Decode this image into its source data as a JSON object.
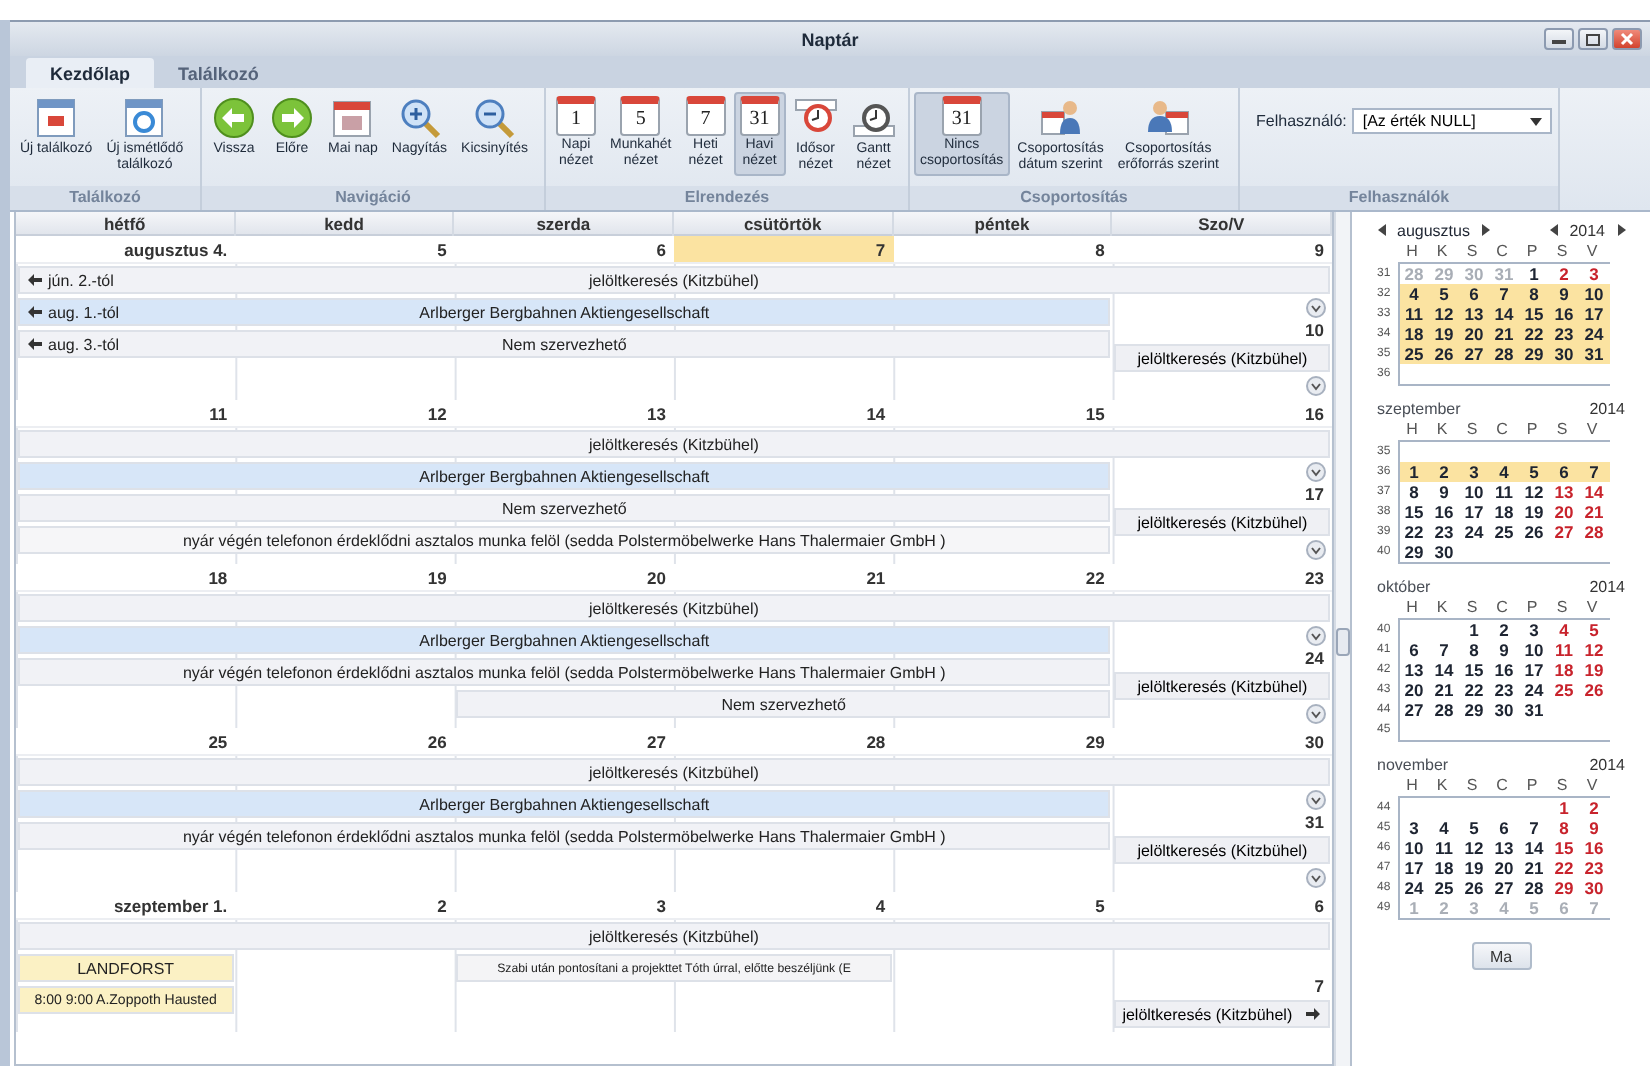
{
  "window": {
    "title": "Naptár"
  },
  "tabs": [
    {
      "label": "Kezdőlap",
      "selected": true
    },
    {
      "label": "Találkozó",
      "selected": false
    }
  ],
  "ribbon": [
    {
      "title": "Találkozó",
      "kind": "buttons",
      "buttons": [
        {
          "label": "Új találkozó",
          "selected": false
        },
        {
          "label": "Új ismétlődő\ntalálkozó",
          "selected": false
        }
      ]
    },
    {
      "title": "Navigáció",
      "kind": "buttons",
      "buttons": [
        {
          "label": "Vissza",
          "selected": false
        },
        {
          "label": "Előre",
          "selected": false
        },
        {
          "label": "Mai nap",
          "selected": false
        },
        {
          "label": "Nagyítás",
          "selected": false
        },
        {
          "label": "Kicsinyítés",
          "selected": false
        }
      ]
    },
    {
      "title": "Elrendezés",
      "kind": "buttons",
      "buttons": [
        {
          "label": "Napi\nnézet",
          "badge": "1",
          "selected": false
        },
        {
          "label": "Munkahét\nnézet",
          "badge": "5",
          "selected": false
        },
        {
          "label": "Heti\nnézet",
          "badge": "7",
          "selected": false
        },
        {
          "label": "Havi\nnézet",
          "badge": "31",
          "selected": true
        },
        {
          "label": "Idősor\nnézet",
          "selected": false
        },
        {
          "label": "Gantt\nnézet",
          "selected": false
        }
      ]
    },
    {
      "title": "Csoportosítás",
      "kind": "buttons",
      "buttons": [
        {
          "label": "Nincs\ncsoportosítás",
          "badge": "31",
          "selected": true
        },
        {
          "label": "Csoportosítás\ndátum szerint",
          "selected": false
        },
        {
          "label": "Csoportosítás\nerőforrás szerint",
          "selected": false
        }
      ]
    },
    {
      "title": "Felhasználók",
      "kind": "filter",
      "filter": {
        "label": "Felhasználó:",
        "value": "[Az érték NULL]"
      }
    }
  ],
  "calendar": {
    "columns": [
      "hétfő",
      "kedd",
      "szerda",
      "csütörtök",
      "péntek",
      "Szo/V"
    ],
    "weeks": [
      {
        "days": [
          {
            "label": "augusztus 4.",
            "today": false
          },
          {
            "label": "5",
            "today": false
          },
          {
            "label": "6",
            "today": false
          },
          {
            "label": "7",
            "today": true
          },
          {
            "label": "8",
            "today": false
          },
          {
            "label": "9",
            "today": false
          }
        ],
        "all_week": {
          "title": "jelöltkeresés (Kitzbühel)",
          "from": "jún. 2.-tól",
          "color": "#f1f2f6"
        },
        "lines": [
          [
            {
              "kind": "event",
              "title": "Arlberger Bergbahnen Aktiengesellschaft",
              "from": "aug. 1.-tól",
              "color": "#d7e6f8"
            },
            {
              "kind": "continued"
            },
            {
              "kind": "continued"
            },
            {
              "kind": "continued"
            },
            {
              "kind": "continued"
            }
          ],
          [
            {
              "kind": "event",
              "title": "Nem szervezhető",
              "from": "aug. 3.-tól",
              "color": "#f1f2f6"
            },
            {
              "kind": "continued"
            },
            {
              "kind": "continued"
            },
            {
              "kind": "continued"
            },
            {
              "kind": "continued"
            }
          ]
        ],
        "weekend": {
          "sat_more": true,
          "sunday": "10",
          "events": [
            {
              "title": "jelöltkeresés (Kitzbühel)",
              "continues": false
            }
          ],
          "sun_more": true
        }
      },
      {
        "days": [
          {
            "label": "11",
            "today": false
          },
          {
            "label": "12",
            "today": false
          },
          {
            "label": "13",
            "today": false
          },
          {
            "label": "14",
            "today": false
          },
          {
            "label": "15",
            "today": false
          },
          {
            "label": "16",
            "today": false
          }
        ],
        "all_week": {
          "title": "jelöltkeresés (Kitzbühel)",
          "color": "#f1f2f6"
        },
        "lines": [
          [
            {
              "kind": "event",
              "title": "Arlberger Bergbahnen Aktiengesellschaft",
              "color": "#d7e6f8"
            },
            {
              "kind": "continued"
            },
            {
              "kind": "continued"
            },
            {
              "kind": "continued"
            },
            {
              "kind": "continued"
            }
          ],
          [
            {
              "kind": "event",
              "title": "Nem szervezhető",
              "color": "#f1f2f6"
            },
            {
              "kind": "continued"
            },
            {
              "kind": "continued"
            },
            {
              "kind": "continued"
            },
            {
              "kind": "continued"
            }
          ],
          [
            {
              "kind": "event",
              "title": "nyár végén telefonon érdeklődni asztalos munka felöl (sedda Polstermöbelwerke Hans Thalermaier GmbH )",
              "color": "#f6f6f8"
            },
            {
              "kind": "continued"
            },
            {
              "kind": "continued"
            },
            {
              "kind": "continued"
            },
            {
              "kind": "continued"
            }
          ]
        ],
        "weekend": {
          "sat_more": true,
          "sunday": "17",
          "events": [
            {
              "title": "jelöltkeresés (Kitzbühel)",
              "continues": false
            }
          ],
          "sun_more": true
        }
      },
      {
        "days": [
          {
            "label": "18",
            "today": false
          },
          {
            "label": "19",
            "today": false
          },
          {
            "label": "20",
            "today": false
          },
          {
            "label": "21",
            "today": false
          },
          {
            "label": "22",
            "today": false
          },
          {
            "label": "23",
            "today": false
          }
        ],
        "all_week": {
          "title": "jelöltkeresés (Kitzbühel)",
          "color": "#f1f2f6"
        },
        "lines": [
          [
            {
              "kind": "event",
              "title": "Arlberger Bergbahnen Aktiengesellschaft",
              "color": "#d7e6f8"
            },
            {
              "kind": "continued"
            },
            {
              "kind": "continued"
            },
            {
              "kind": "continued"
            },
            {
              "kind": "continued"
            }
          ],
          [
            {
              "kind": "event",
              "title": "nyár végén telefonon érdeklődni asztalos munka felöl (sedda Polstermöbelwerke Hans Thalermaier GmbH )",
              "color": "#f1f2f6"
            },
            {
              "kind": "continued"
            },
            {
              "kind": "continued"
            },
            {
              "kind": "continued"
            },
            {
              "kind": "continued"
            }
          ],
          [
            {
              "kind": "empty"
            },
            {
              "kind": "empty"
            },
            {
              "kind": "event",
              "title": "Nem szervezhető",
              "color": "#f1f2f6"
            },
            {
              "kind": "continued"
            },
            {
              "kind": "continued"
            }
          ]
        ],
        "weekend": {
          "sat_more": true,
          "sunday": "24",
          "events": [
            {
              "title": "jelöltkeresés (Kitzbühel)",
              "continues": false
            }
          ],
          "sun_more": true
        }
      },
      {
        "days": [
          {
            "label": "25",
            "today": false
          },
          {
            "label": "26",
            "today": false
          },
          {
            "label": "27",
            "today": false
          },
          {
            "label": "28",
            "today": false
          },
          {
            "label": "29",
            "today": false
          },
          {
            "label": "30",
            "today": false
          }
        ],
        "all_week": {
          "title": "jelöltkeresés (Kitzbühel)",
          "color": "#f1f2f6"
        },
        "lines": [
          [
            {
              "kind": "event",
              "title": "Arlberger Bergbahnen Aktiengesellschaft",
              "color": "#d7e6f8"
            },
            {
              "kind": "continued"
            },
            {
              "kind": "continued"
            },
            {
              "kind": "continued"
            },
            {
              "kind": "continued"
            }
          ],
          [
            {
              "kind": "event",
              "title": "nyár végén telefonon érdeklődni asztalos munka felöl (sedda Polstermöbelwerke Hans Thalermaier GmbH )",
              "color": "#f1f2f6"
            },
            {
              "kind": "continued"
            },
            {
              "kind": "continued"
            },
            {
              "kind": "continued"
            },
            {
              "kind": "continued"
            }
          ]
        ],
        "weekend": {
          "sat_more": true,
          "sunday": "31",
          "events": [
            {
              "title": "jelöltkeresés (Kitzbühel)",
              "continues": false
            }
          ],
          "sun_more": true
        }
      },
      {
        "days": [
          {
            "label": "szeptember 1.",
            "today": false
          },
          {
            "label": "2",
            "today": false
          },
          {
            "label": "3",
            "today": false
          },
          {
            "label": "4",
            "today": false
          },
          {
            "label": "5",
            "today": false
          },
          {
            "label": "6",
            "today": false
          }
        ],
        "all_week": {
          "title": "jelöltkeresés (Kitzbühel)",
          "color": "#f1f2f6"
        },
        "lines": [
          [
            {
              "kind": "event",
              "title": "LANDFORST",
              "color": "#fbf1c4"
            },
            {
              "kind": "empty"
            },
            {
              "kind": "event",
              "title": "Szabi után pontosítani  a projekttet Tóth úrral, előtte beszéljünk (E",
              "color": "#f4f4f6"
            },
            {
              "kind": "continued"
            },
            {
              "kind": "empty"
            }
          ],
          [
            {
              "kind": "event",
              "title": "8:00  9:00  A.Zoppoth Hausted",
              "color": "#fbf1c4"
            },
            {
              "kind": "empty"
            },
            {
              "kind": "empty"
            },
            {
              "kind": "empty"
            },
            {
              "kind": "empty"
            }
          ]
        ],
        "weekend": {
          "sat_more": false,
          "sunday": "7",
          "events": [
            {
              "title": "jelöltkeresés (Kitzbühel)",
              "continues": true
            }
          ],
          "sun_more": false
        }
      }
    ]
  },
  "mini_calendars": [
    {
      "month": "augusztus",
      "year": "2014",
      "nav": true,
      "weekdays": [
        "H",
        "K",
        "S",
        "C",
        "P",
        "S",
        "V"
      ],
      "weeks": [
        {
          "number": "31",
          "selected": false,
          "days": [
            {
              "label": "28",
              "kind": "other"
            },
            {
              "label": "29",
              "kind": "other"
            },
            {
              "label": "30",
              "kind": "other"
            },
            {
              "label": "31",
              "kind": "other"
            },
            {
              "label": "1",
              "kind": "work"
            },
            {
              "label": "2",
              "kind": "weekend"
            },
            {
              "label": "3",
              "kind": "weekend"
            }
          ]
        },
        {
          "number": "32",
          "selected": true,
          "days": [
            {
              "label": "4",
              "kind": "work"
            },
            {
              "label": "5",
              "kind": "work"
            },
            {
              "label": "6",
              "kind": "work"
            },
            {
              "label": "7",
              "kind": "work"
            },
            {
              "label": "8",
              "kind": "work"
            },
            {
              "label": "9",
              "kind": "weekend"
            },
            {
              "label": "10",
              "kind": "weekend"
            }
          ]
        },
        {
          "number": "33",
          "selected": true,
          "days": [
            {
              "label": "11",
              "kind": "work"
            },
            {
              "label": "12",
              "kind": "work"
            },
            {
              "label": "13",
              "kind": "work"
            },
            {
              "label": "14",
              "kind": "work"
            },
            {
              "label": "15",
              "kind": "work"
            },
            {
              "label": "16",
              "kind": "weekend"
            },
            {
              "label": "17",
              "kind": "weekend"
            }
          ]
        },
        {
          "number": "34",
          "selected": true,
          "days": [
            {
              "label": "18",
              "kind": "work"
            },
            {
              "label": "19",
              "kind": "work"
            },
            {
              "label": "20",
              "kind": "work"
            },
            {
              "label": "21",
              "kind": "work"
            },
            {
              "label": "22",
              "kind": "work"
            },
            {
              "label": "23",
              "kind": "weekend"
            },
            {
              "label": "24",
              "kind": "weekend"
            }
          ]
        },
        {
          "number": "35",
          "selected": true,
          "days": [
            {
              "label": "25",
              "kind": "work"
            },
            {
              "label": "26",
              "kind": "work"
            },
            {
              "label": "27",
              "kind": "work"
            },
            {
              "label": "28",
              "kind": "work"
            },
            {
              "label": "29",
              "kind": "work"
            },
            {
              "label": "30",
              "kind": "weekend"
            },
            {
              "label": "31",
              "kind": "weekend"
            }
          ]
        },
        {
          "number": "36"
        }
      ]
    },
    {
      "month": "szeptember",
      "year": "2014",
      "nav": false,
      "weekdays": [
        "H",
        "K",
        "S",
        "C",
        "P",
        "S",
        "V"
      ],
      "weeks": [
        {
          "number": "35"
        },
        {
          "number": "36",
          "selected": true,
          "days": [
            {
              "label": "1",
              "kind": "work"
            },
            {
              "label": "2",
              "kind": "work"
            },
            {
              "label": "3",
              "kind": "work"
            },
            {
              "label": "4",
              "kind": "work"
            },
            {
              "label": "5",
              "kind": "work"
            },
            {
              "label": "6",
              "kind": "weekend"
            },
            {
              "label": "7",
              "kind": "weekend"
            }
          ]
        },
        {
          "number": "37",
          "selected": false,
          "days": [
            {
              "label": "8",
              "kind": "work"
            },
            {
              "label": "9",
              "kind": "work"
            },
            {
              "label": "10",
              "kind": "work"
            },
            {
              "label": "11",
              "kind": "work"
            },
            {
              "label": "12",
              "kind": "work"
            },
            {
              "label": "13",
              "kind": "weekend"
            },
            {
              "label": "14",
              "kind": "weekend"
            }
          ]
        },
        {
          "number": "38",
          "selected": false,
          "days": [
            {
              "label": "15",
              "kind": "work"
            },
            {
              "label": "16",
              "kind": "work"
            },
            {
              "label": "17",
              "kind": "work"
            },
            {
              "label": "18",
              "kind": "work"
            },
            {
              "label": "19",
              "kind": "work"
            },
            {
              "label": "20",
              "kind": "weekend"
            },
            {
              "label": "21",
              "kind": "weekend"
            }
          ]
        },
        {
          "number": "39",
          "selected": false,
          "days": [
            {
              "label": "22",
              "kind": "work"
            },
            {
              "label": "23",
              "kind": "work"
            },
            {
              "label": "24",
              "kind": "work"
            },
            {
              "label": "25",
              "kind": "work"
            },
            {
              "label": "26",
              "kind": "work"
            },
            {
              "label": "27",
              "kind": "weekend"
            },
            {
              "label": "28",
              "kind": "weekend"
            }
          ]
        },
        {
          "number": "40",
          "selected": false,
          "days": [
            {
              "label": "29",
              "kind": "work"
            },
            {
              "label": "30",
              "kind": "work"
            }
          ]
        }
      ]
    },
    {
      "month": "október",
      "year": "2014",
      "nav": false,
      "weekdays": [
        "H",
        "K",
        "S",
        "C",
        "P",
        "S",
        "V"
      ],
      "weeks": [
        {
          "number": "40",
          "selected": false,
          "days": [
            {
              "kind": "blank"
            },
            {
              "kind": "blank"
            },
            {
              "label": "1",
              "kind": "work"
            },
            {
              "label": "2",
              "kind": "work"
            },
            {
              "label": "3",
              "kind": "work"
            },
            {
              "label": "4",
              "kind": "weekend"
            },
            {
              "label": "5",
              "kind": "weekend"
            }
          ]
        },
        {
          "number": "41",
          "selected": false,
          "days": [
            {
              "label": "6",
              "kind": "work"
            },
            {
              "label": "7",
              "kind": "work"
            },
            {
              "label": "8",
              "kind": "work"
            },
            {
              "label": "9",
              "kind": "work"
            },
            {
              "label": "10",
              "kind": "work"
            },
            {
              "label": "11",
              "kind": "weekend"
            },
            {
              "label": "12",
              "kind": "weekend"
            }
          ]
        },
        {
          "number": "42",
          "selected": false,
          "days": [
            {
              "label": "13",
              "kind": "work"
            },
            {
              "label": "14",
              "kind": "work"
            },
            {
              "label": "15",
              "kind": "work"
            },
            {
              "label": "16",
              "kind": "work"
            },
            {
              "label": "17",
              "kind": "work"
            },
            {
              "label": "18",
              "kind": "weekend"
            },
            {
              "label": "19",
              "kind": "weekend"
            }
          ]
        },
        {
          "number": "43",
          "selected": false,
          "days": [
            {
              "label": "20",
              "kind": "work"
            },
            {
              "label": "21",
              "kind": "work"
            },
            {
              "label": "22",
              "kind": "work"
            },
            {
              "label": "23",
              "kind": "work"
            },
            {
              "label": "24",
              "kind": "work"
            },
            {
              "label": "25",
              "kind": "weekend"
            },
            {
              "label": "26",
              "kind": "weekend"
            }
          ]
        },
        {
          "number": "44",
          "selected": false,
          "days": [
            {
              "label": "27",
              "kind": "work"
            },
            {
              "label": "28",
              "kind": "work"
            },
            {
              "label": "29",
              "kind": "work"
            },
            {
              "label": "30",
              "kind": "work"
            },
            {
              "label": "31",
              "kind": "work"
            }
          ]
        },
        {
          "number": "45"
        }
      ]
    },
    {
      "month": "november",
      "year": "2014",
      "nav": false,
      "weekdays": [
        "H",
        "K",
        "S",
        "C",
        "P",
        "S",
        "V"
      ],
      "weeks": [
        {
          "number": "44",
          "selected": false,
          "days": [
            {
              "kind": "blank"
            },
            {
              "kind": "blank"
            },
            {
              "kind": "blank"
            },
            {
              "kind": "blank"
            },
            {
              "kind": "blank"
            },
            {
              "label": "1",
              "kind": "weekend"
            },
            {
              "label": "2",
              "kind": "weekend"
            }
          ]
        },
        {
          "number": "45",
          "selected": false,
          "days": [
            {
              "label": "3",
              "kind": "work"
            },
            {
              "label": "4",
              "kind": "work"
            },
            {
              "label": "5",
              "kind": "work"
            },
            {
              "label": "6",
              "kind": "work"
            },
            {
              "label": "7",
              "kind": "work"
            },
            {
              "label": "8",
              "kind": "weekend"
            },
            {
              "label": "9",
              "kind": "weekend"
            }
          ]
        },
        {
          "number": "46",
          "selected": false,
          "days": [
            {
              "label": "10",
              "kind": "work"
            },
            {
              "label": "11",
              "kind": "work"
            },
            {
              "label": "12",
              "kind": "work"
            },
            {
              "label": "13",
              "kind": "work"
            },
            {
              "label": "14",
              "kind": "work"
            },
            {
              "label": "15",
              "kind": "weekend"
            },
            {
              "label": "16",
              "kind": "weekend"
            }
          ]
        },
        {
          "number": "47",
          "selected": false,
          "days": [
            {
              "label": "17",
              "kind": "work"
            },
            {
              "label": "18",
              "kind": "work"
            },
            {
              "label": "19",
              "kind": "work"
            },
            {
              "label": "20",
              "kind": "work"
            },
            {
              "label": "21",
              "kind": "work"
            },
            {
              "label": "22",
              "kind": "weekend"
            },
            {
              "label": "23",
              "kind": "weekend"
            }
          ]
        },
        {
          "number": "48",
          "selected": false,
          "days": [
            {
              "label": "24",
              "kind": "work"
            },
            {
              "label": "25",
              "kind": "work"
            },
            {
              "label": "26",
              "kind": "work"
            },
            {
              "label": "27",
              "kind": "work"
            },
            {
              "label": "28",
              "kind": "work"
            },
            {
              "label": "29",
              "kind": "weekend"
            },
            {
              "label": "30",
              "kind": "weekend"
            }
          ]
        },
        {
          "number": "49",
          "selected": false,
          "days": [
            {
              "label": "1",
              "kind": "other"
            },
            {
              "label": "2",
              "kind": "other"
            },
            {
              "label": "3",
              "kind": "other"
            },
            {
              "label": "4",
              "kind": "other"
            },
            {
              "label": "5",
              "kind": "other"
            },
            {
              "label": "6",
              "kind": "other"
            },
            {
              "label": "7",
              "kind": "other"
            }
          ]
        }
      ]
    }
  ],
  "today_button": "Ma"
}
